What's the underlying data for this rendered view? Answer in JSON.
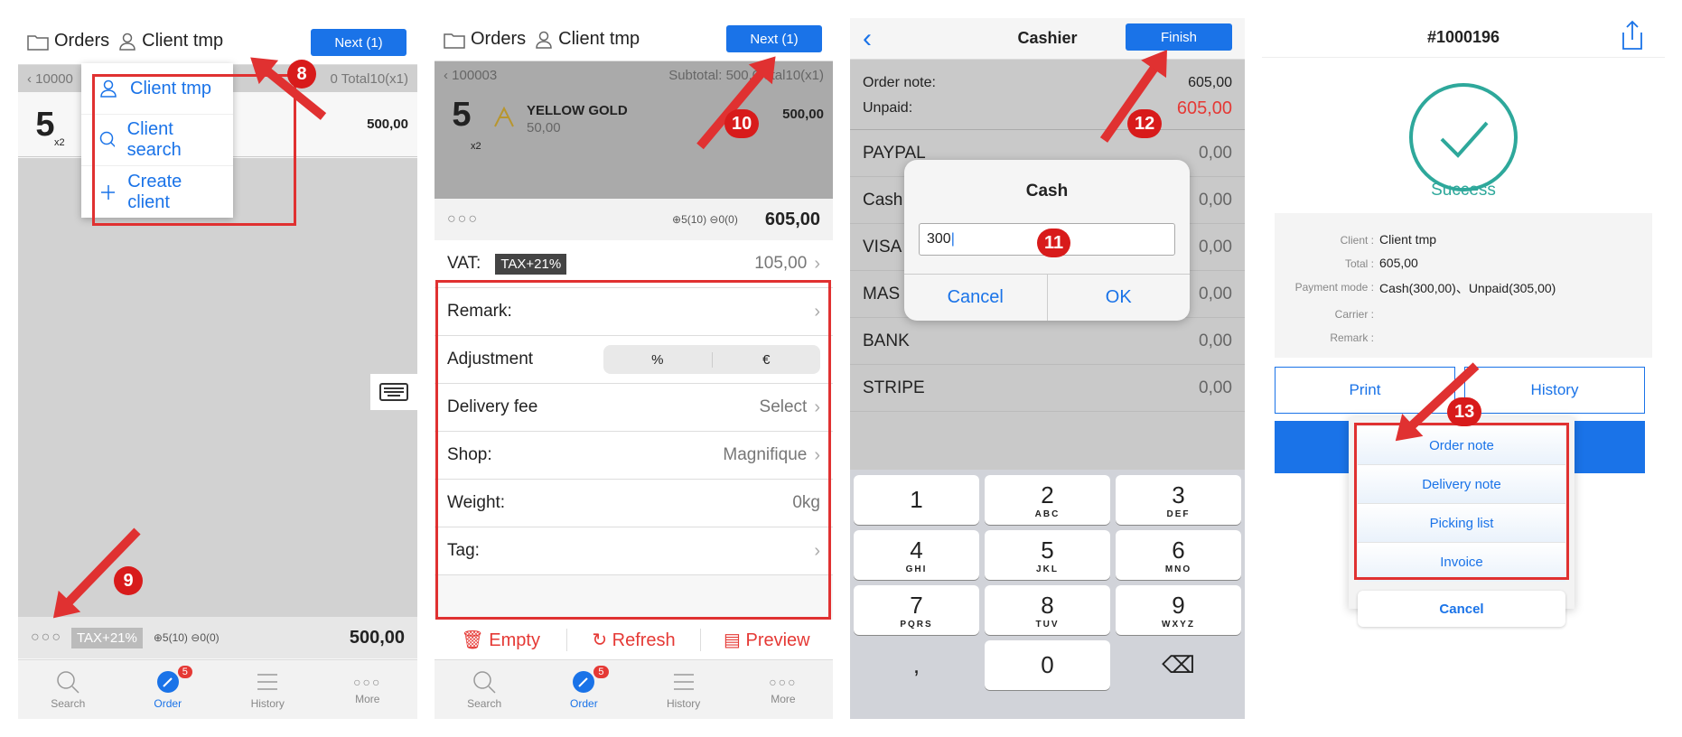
{
  "colors": {
    "accent": "#1a73e8",
    "annotation": "#e03131",
    "success": "#2ea89b",
    "unpaid": "#e53935"
  },
  "panel1": {
    "orders": "Orders",
    "client": "Client tmp",
    "next": "Next  (1)",
    "order_no": "10000",
    "subtotal_tail": "0 Total10(x1)",
    "item": {
      "qty": "5",
      "qty_sub": "x2",
      "price": "500,00"
    },
    "menu": [
      {
        "icon": "user-icon",
        "label": "Client tmp"
      },
      {
        "icon": "search-icon",
        "label": "Client search"
      },
      {
        "icon": "plus-icon",
        "label": "Create client"
      }
    ],
    "summary": {
      "dots": "○○○",
      "tax": "TAX+21%",
      "plus": "5(10)",
      "minus": "0(0)",
      "total": "500,00"
    },
    "step_a": "8",
    "step_b": "9"
  },
  "tabs": [
    {
      "label": "Search",
      "icon": "search-icon"
    },
    {
      "label": "Order",
      "icon": "order-icon",
      "badge": "5"
    },
    {
      "label": "History",
      "icon": "list-icon"
    },
    {
      "label": "More",
      "icon": "more-icon"
    }
  ],
  "panel2": {
    "orders": "Orders",
    "client": "Client tmp",
    "next": "Next  (1)",
    "order_no": "100003",
    "subtotal": "Subtotal: 500,0",
    "total_tail": "otal10(x1)",
    "item": {
      "qty": "5",
      "qty_sub": "x2",
      "name": "YELLOW GOLD",
      "unit": "50,00",
      "price": "500,00"
    },
    "summary": {
      "dots": "○○○",
      "plus": "5(10)",
      "minus": "0(0)",
      "total": "605,00"
    },
    "rows": {
      "vat_label": "VAT:",
      "vat_tag": "TAX+21%",
      "vat_val": "105,00",
      "remark": "Remark:",
      "adjustment": "Adjustment",
      "pct": "%",
      "eur": "€",
      "delivery": "Delivery fee",
      "delivery_val": "Select",
      "shop": "Shop:",
      "shop_val": "Magnifique",
      "weight": "Weight:",
      "weight_val": "0kg",
      "tag": "Tag:"
    },
    "actions": {
      "empty": "Empty",
      "refresh": "Refresh",
      "preview": "Preview"
    },
    "step": "10"
  },
  "panel3": {
    "title": "Cashier",
    "finish": "Finish",
    "order_note": "Order note:",
    "order_note_val": "605,00",
    "unpaid": "Unpaid:",
    "unpaid_val": "605,00",
    "methods": [
      {
        "name": "PAYPAL",
        "amt": "0,00"
      },
      {
        "name": "Cash",
        "amt": "0,00"
      },
      {
        "name": "VISA",
        "amt": "0,00"
      },
      {
        "name": "MAS",
        "amt": "0,00"
      },
      {
        "name": "BANK",
        "amt": "0,00"
      },
      {
        "name": "STRIPE",
        "amt": "0,00"
      }
    ],
    "dialog": {
      "title": "Cash",
      "value": "300",
      "cancel": "Cancel",
      "ok": "OK"
    },
    "keys": [
      {
        "d": "1",
        "l": ""
      },
      {
        "d": "2",
        "l": "ABC"
      },
      {
        "d": "3",
        "l": "DEF"
      },
      {
        "d": "4",
        "l": "GHI"
      },
      {
        "d": "5",
        "l": "JKL"
      },
      {
        "d": "6",
        "l": "MNO"
      },
      {
        "d": "7",
        "l": "PQRS"
      },
      {
        "d": "8",
        "l": "TUV"
      },
      {
        "d": "9",
        "l": "WXYZ"
      },
      {
        "d": ",",
        "l": ""
      },
      {
        "d": "0",
        "l": ""
      },
      {
        "d": "⌫",
        "l": ""
      }
    ],
    "step_a": "11",
    "step_b": "12"
  },
  "panel4": {
    "order_id": "#1000196",
    "success": "Success",
    "details": [
      {
        "label": "Client :",
        "value": "Client tmp"
      },
      {
        "label": "Total :",
        "value": "605,00"
      },
      {
        "label": "Payment mode :",
        "value": "Cash(300,00)、Unpaid(305,00)"
      },
      {
        "label": "Carrier :",
        "value": ""
      },
      {
        "label": "Remark :",
        "value": ""
      }
    ],
    "print": "Print",
    "history": "History",
    "sheet": [
      "Order note",
      "Delivery note",
      "Picking list",
      "Invoice"
    ],
    "cancel": "Cancel",
    "step": "13"
  }
}
